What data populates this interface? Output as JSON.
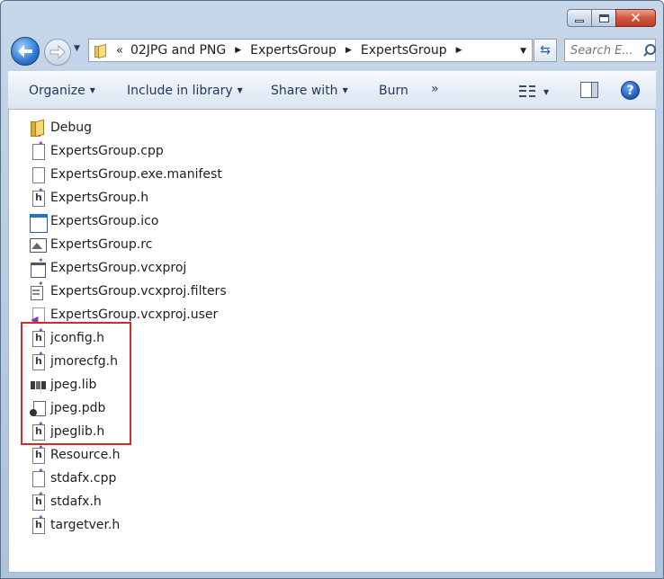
{
  "window": {
    "caption_icons": [
      "minimize-icon",
      "maximize-icon",
      "close-icon"
    ],
    "close_glyph": "✕"
  },
  "nav": {
    "back_icon": "back-arrow-icon",
    "forward_icon": "forward-arrow-icon",
    "breadcrumb_overflow": "«",
    "breadcrumb": [
      "02JPG and PNG",
      "ExpertsGroup",
      "ExpertsGroup"
    ],
    "search_placeholder": "Search E..."
  },
  "toolbar": {
    "organize": "Organize",
    "include_in_library": "Include in library",
    "share_with": "Share with",
    "burn": "Burn",
    "more": "»",
    "help": "?"
  },
  "files": [
    {
      "name": "Debug",
      "icon": "folder-icon"
    },
    {
      "name": "ExpertsGroup.cpp",
      "icon": "cpp-file-icon"
    },
    {
      "name": "ExpertsGroup.exe.manifest",
      "icon": "blank-file-icon"
    },
    {
      "name": "ExpertsGroup.h",
      "icon": "header-file-icon"
    },
    {
      "name": "ExpertsGroup.ico",
      "icon": "ico-file-icon"
    },
    {
      "name": "ExpertsGroup.rc",
      "icon": "resource-file-icon"
    },
    {
      "name": "ExpertsGroup.vcxproj",
      "icon": "project-file-icon"
    },
    {
      "name": "ExpertsGroup.vcxproj.filters",
      "icon": "filters-file-icon"
    },
    {
      "name": "ExpertsGroup.vcxproj.user",
      "icon": "user-file-icon"
    },
    {
      "name": "jconfig.h",
      "icon": "header-file-icon"
    },
    {
      "name": "jmorecfg.h",
      "icon": "header-file-icon"
    },
    {
      "name": "jpeg.lib",
      "icon": "library-file-icon"
    },
    {
      "name": "jpeg.pdb",
      "icon": "pdb-file-icon"
    },
    {
      "name": "jpeglib.h",
      "icon": "header-file-icon"
    },
    {
      "name": "Resource.h",
      "icon": "header-file-icon"
    },
    {
      "name": "stdafx.cpp",
      "icon": "cpp-file-icon"
    },
    {
      "name": "stdafx.h",
      "icon": "header-file-icon"
    },
    {
      "name": "targetver.h",
      "icon": "header-file-icon"
    }
  ],
  "highlight": {
    "color": "#d5272c",
    "files": [
      "jconfig.h",
      "jmorecfg.h",
      "jpeg.lib",
      "jpeg.pdb",
      "jpeglib.h"
    ]
  }
}
